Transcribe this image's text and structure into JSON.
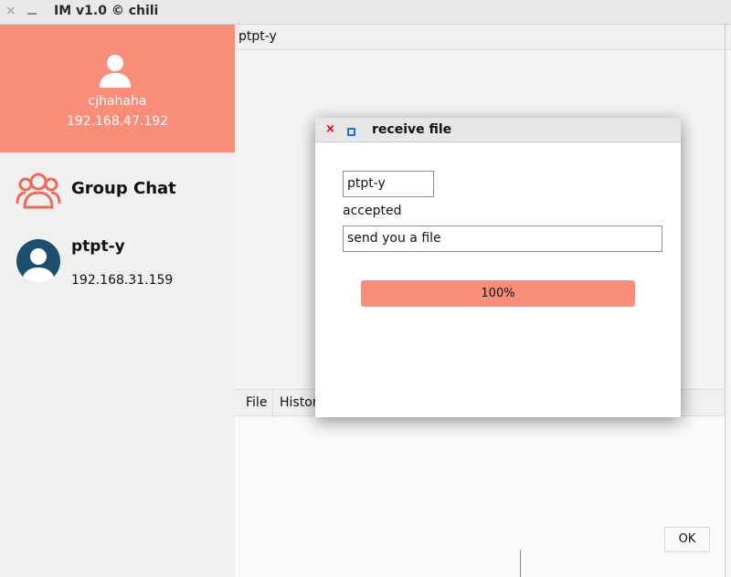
{
  "window": {
    "title": "IM v1.0 © chili",
    "close_glyph": "×"
  },
  "profile": {
    "name": "cjhahaha",
    "ip": "192.168.47.192",
    "accent_color": "#fa8c7a"
  },
  "contacts": [
    {
      "name": "Group Chat",
      "icon": "group-icon"
    },
    {
      "name": "ptpt-y",
      "ip": "192.168.31.159",
      "icon": "user-avatar-icon"
    }
  ],
  "chat": {
    "title": "ptpt-y",
    "tabs": [
      "File",
      "Histor"
    ],
    "ok_label": "OK"
  },
  "dialog": {
    "title": "receive file",
    "close_glyph": "×",
    "sender": "ptpt-y",
    "status": "accepted",
    "message": "send you a file",
    "progress_label": "100%",
    "progress": 1.0
  }
}
